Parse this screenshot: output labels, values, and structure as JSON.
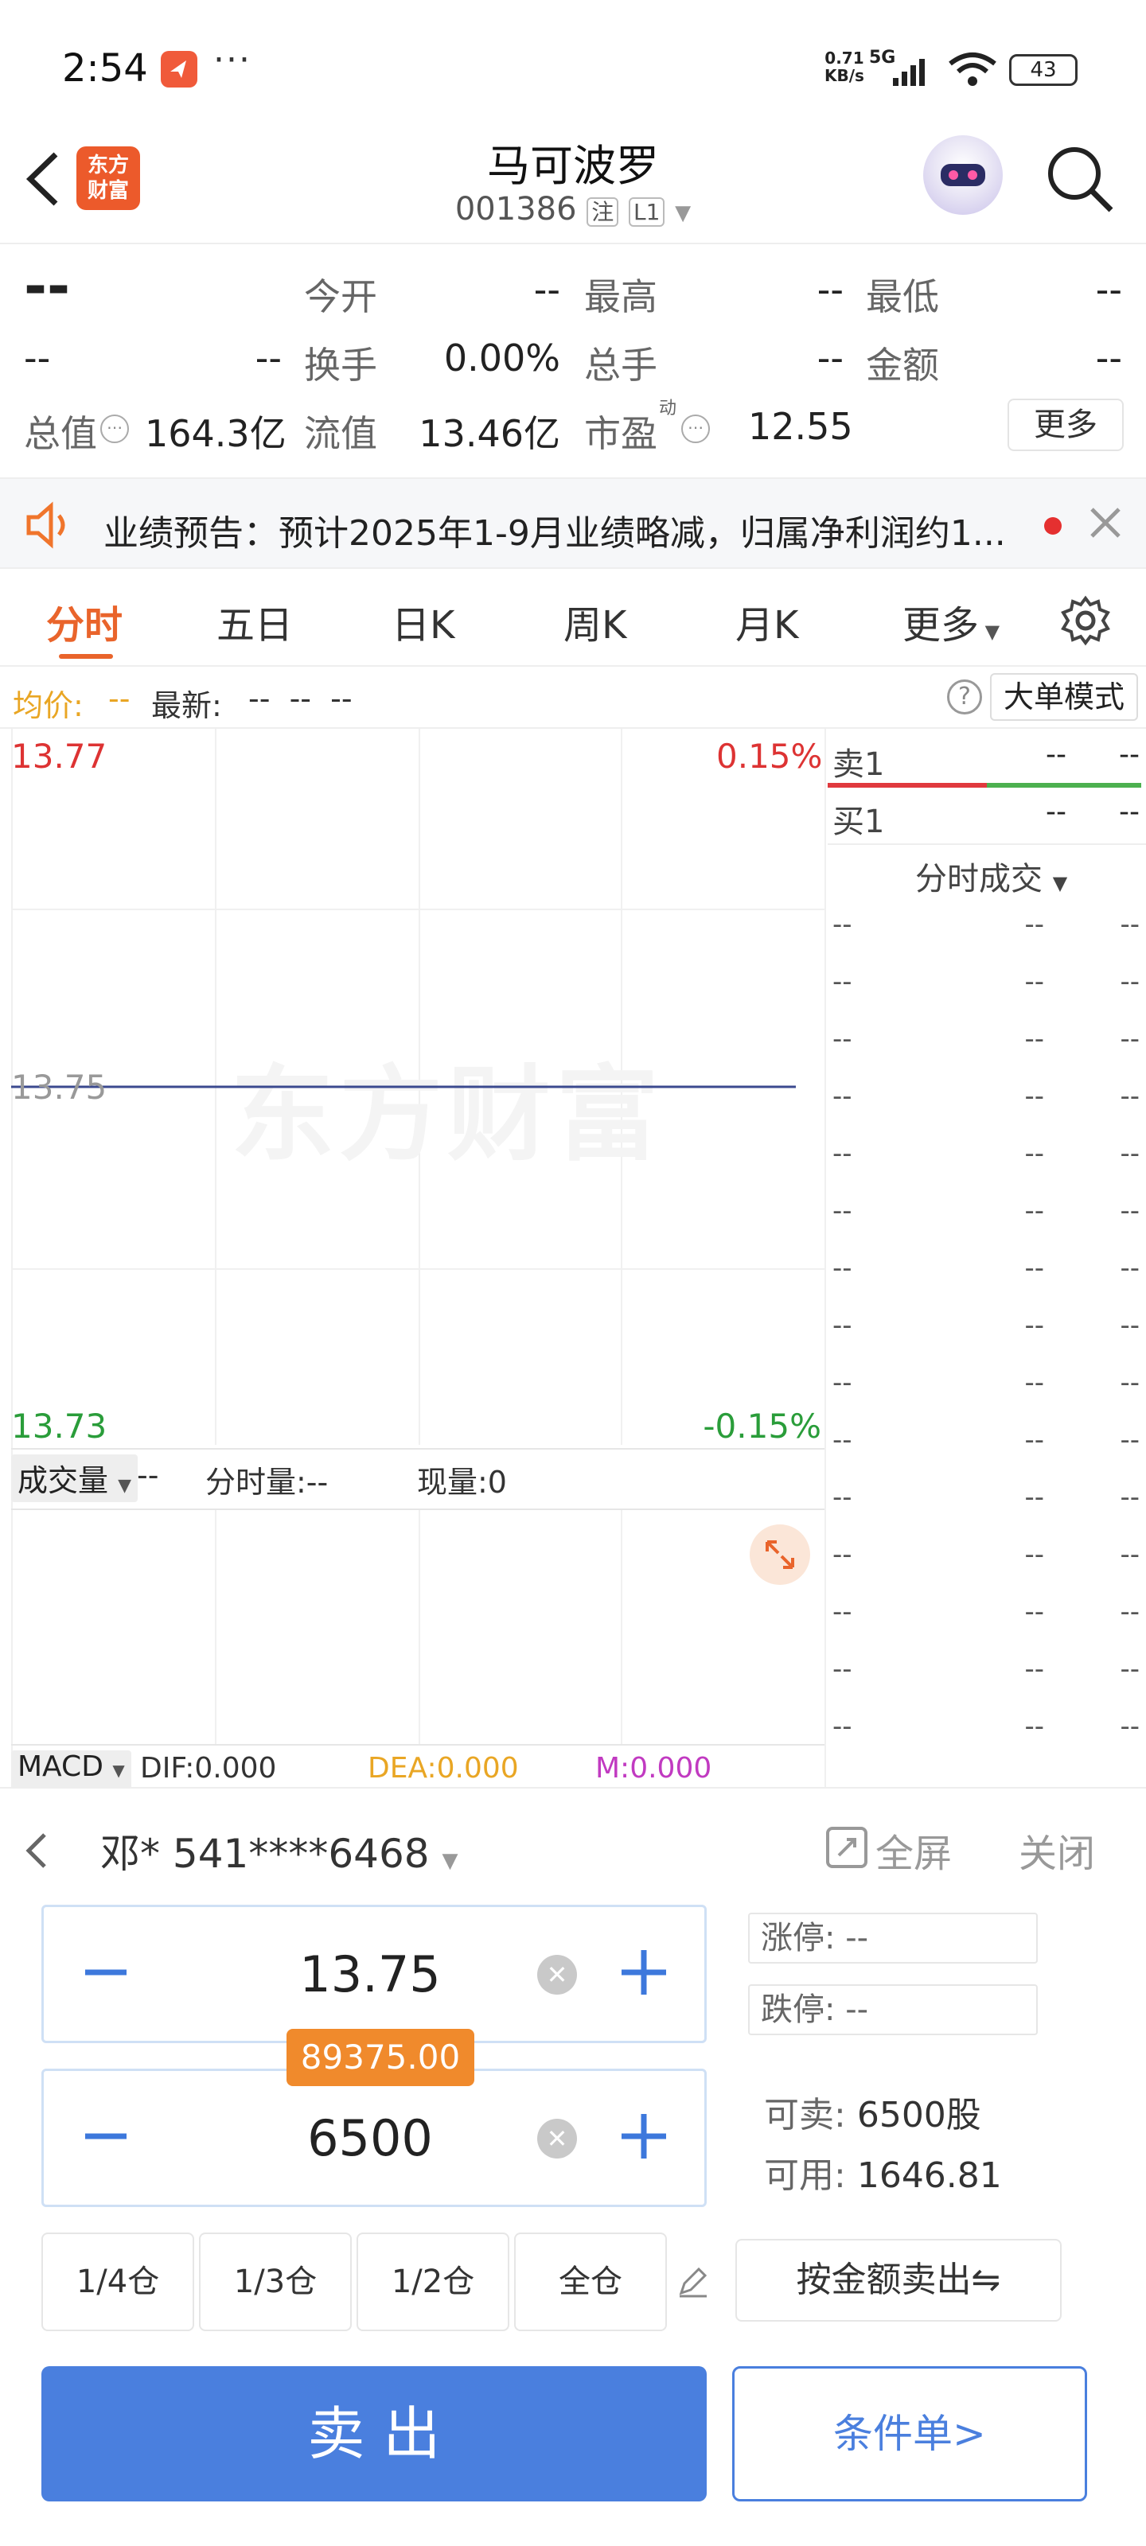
{
  "status_bar": {
    "time": "2:54",
    "dots": "···",
    "net_speed": "0.71\nKB/s",
    "net_value": "0.71",
    "net_unit": "KB/s",
    "network": "5G",
    "battery": "43"
  },
  "header": {
    "logo_text_1": "东方",
    "logo_text_2": "财富",
    "title": "马可波罗",
    "code": "001386",
    "tag_zhu": "注",
    "tag_level": "L1"
  },
  "quote": {
    "price": "--",
    "change_a": "--",
    "change_b": "--",
    "open_label": "今开",
    "open": "--",
    "high_label": "最高",
    "high": "--",
    "low_label": "最低",
    "low": "--",
    "turnover_label": "换手",
    "turnover": "0.00%",
    "volume_label": "总手",
    "volume": "--",
    "amount_label": "金额",
    "amount": "--",
    "mktcap_label": "总值",
    "mktcap": "164.3亿",
    "float_label": "流值",
    "float": "13.46亿",
    "pe_label": "市盈",
    "pe_sup": "动",
    "pe": "12.55",
    "more": "更多"
  },
  "notice": {
    "text": "业绩预告：预计2025年1-9月业绩略减，归属净利润约1..."
  },
  "tabs": [
    "分时",
    "五日",
    "日K",
    "周K",
    "月K",
    "更多"
  ],
  "avgbar": {
    "avg_label": "均价:",
    "avg_value": "--",
    "latest_label": "最新:",
    "latest_value": "--  --  --",
    "big_order": "大单模式"
  },
  "chart": {
    "watermark": "东方财富",
    "price_high": "13.77",
    "price_mid": "13.75",
    "price_low": "13.73",
    "pct_high": "0.15%",
    "pct_low": "-0.15%",
    "vol_select": "成交量",
    "vol_value": "--",
    "minute_vol": "分时量:--",
    "cur_vol": "现量:0",
    "macd_select": "MACD",
    "dif": "DIF:0.000",
    "dea": "DEA:0.000",
    "m": "M:0.000"
  },
  "chart_data": {
    "type": "line",
    "x": [
      0,
      1
    ],
    "series": [
      {
        "values": [
          13.75,
          13.75
        ]
      }
    ],
    "ylim": [
      13.73,
      13.77
    ]
  },
  "book": {
    "sell1_label": "卖1",
    "sell1_price": "--",
    "sell1_vol": "--",
    "buy1_label": "买1",
    "buy1_price": "--",
    "buy1_vol": "--",
    "ticks_title": "分时成交",
    "ticks": [
      [
        "--",
        "--",
        "--"
      ],
      [
        "--",
        "--",
        "--"
      ],
      [
        "--",
        "--",
        "--"
      ],
      [
        "--",
        "--",
        "--"
      ],
      [
        "--",
        "--",
        "--"
      ],
      [
        "--",
        "--",
        "--"
      ],
      [
        "--",
        "--",
        "--"
      ],
      [
        "--",
        "--",
        "--"
      ],
      [
        "--",
        "--",
        "--"
      ],
      [
        "--",
        "--",
        "--"
      ],
      [
        "--",
        "--",
        "--"
      ],
      [
        "--",
        "--",
        "--"
      ],
      [
        "--",
        "--",
        "--"
      ],
      [
        "--",
        "--",
        "--"
      ],
      [
        "--",
        "--",
        "--"
      ]
    ]
  },
  "trade": {
    "account": "邓* 541****6468",
    "fullscreen": "全屏",
    "close": "关闭",
    "price": "13.75",
    "amount_tip": "89375.00",
    "qty": "6500",
    "limit_up_label": "涨停:",
    "limit_up": "--",
    "limit_down_label": "跌停:",
    "limit_down": "--",
    "sellable_label": "可卖:",
    "sellable": "6500股",
    "available_label": "可用:",
    "available": "1646.81",
    "pos_quarter": "1/4仓",
    "pos_third": "1/3仓",
    "pos_half": "1/2仓",
    "pos_full": "全仓",
    "sell_by_amount": "按金额卖出⇋",
    "sell_button": "卖 出",
    "conditional": "条件单>",
    "colors": {
      "sell_blue": "#4a7fde",
      "accent_orange": "#f08a2c"
    }
  }
}
